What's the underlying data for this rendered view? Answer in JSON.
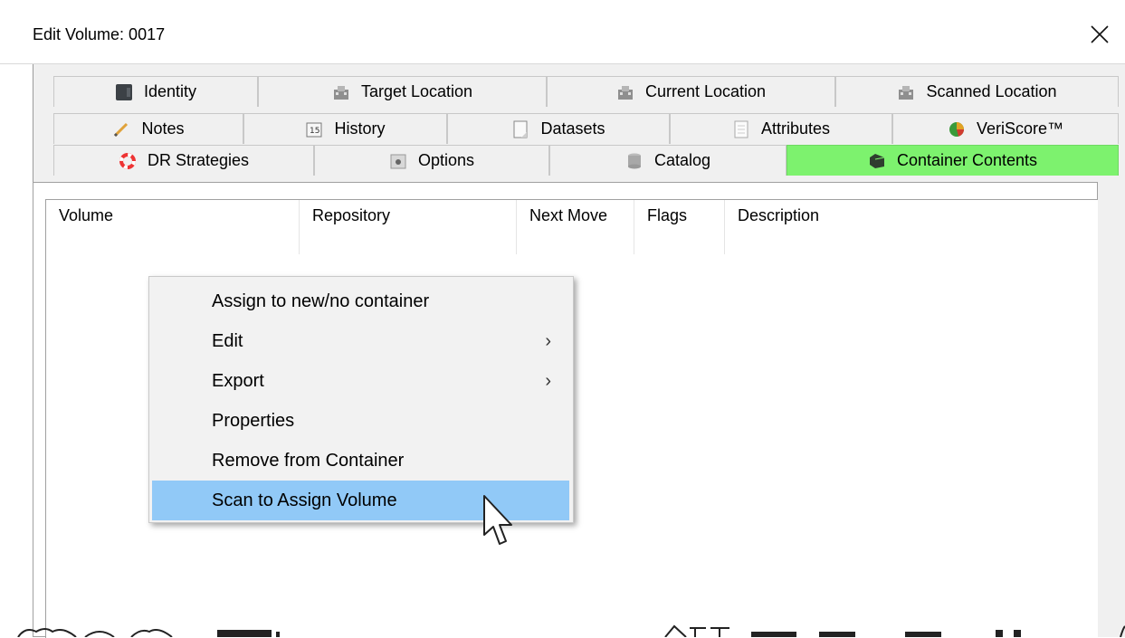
{
  "window": {
    "title": "Edit Volume: 0017"
  },
  "tabs": {
    "row1": [
      {
        "label": "Identity",
        "icon": "identity-card-icon"
      },
      {
        "label": "Target Location",
        "icon": "building-icon"
      },
      {
        "label": "Current Location",
        "icon": "building-icon"
      },
      {
        "label": "Scanned Location",
        "icon": "building-icon"
      }
    ],
    "row2": [
      {
        "label": "Notes",
        "icon": "pencil-icon"
      },
      {
        "label": "History",
        "icon": "calendar-icon"
      },
      {
        "label": "Datasets",
        "icon": "document-icon"
      },
      {
        "label": "Attributes",
        "icon": "list-icon"
      },
      {
        "label": "VeriScore™",
        "icon": "pie-chart-icon"
      }
    ],
    "row3": [
      {
        "label": "DR Strategies",
        "icon": "lifebuoy-icon"
      },
      {
        "label": "Options",
        "icon": "options-icon"
      },
      {
        "label": "Catalog",
        "icon": "database-icon"
      },
      {
        "label": "Container Contents",
        "icon": "container-icon",
        "active": true
      }
    ]
  },
  "list": {
    "columns": [
      "Volume",
      "Repository",
      "Next Move",
      "Flags",
      "Description"
    ]
  },
  "context_menu": {
    "items": [
      {
        "label": "Assign to new/no container",
        "submenu": false
      },
      {
        "label": "Edit",
        "submenu": true
      },
      {
        "label": "Export",
        "submenu": true
      },
      {
        "label": "Properties",
        "submenu": false
      },
      {
        "label": "Remove from Container",
        "submenu": false
      },
      {
        "label": "Scan to Assign Volume",
        "submenu": false,
        "highlighted": true
      }
    ],
    "submenu_glyph": "›"
  },
  "colors": {
    "active_tab": "#7df26e",
    "menu_highlight": "#91c9f7"
  }
}
